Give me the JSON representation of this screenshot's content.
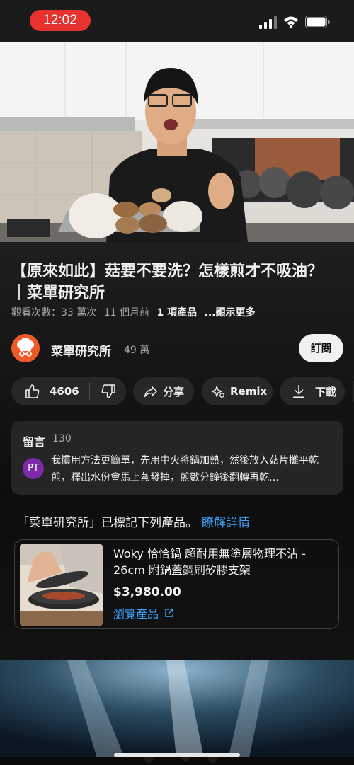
{
  "status_bar": {
    "time": "12:02"
  },
  "video": {
    "label": "video-player"
  },
  "title": "【原來如此】菇要不要洗？怎樣煎才不吸油？｜菜單研究所",
  "meta": {
    "views": "觀看次數：33 萬次",
    "age": "11 個月前",
    "products": "1 項產品",
    "more": "...顯示更多"
  },
  "channel": {
    "name": "菜單研究所",
    "subscribers": "49 萬",
    "subscribe_label": "訂閱"
  },
  "actions": {
    "likes": "4606",
    "share": "分享",
    "remix": "Remix",
    "download": "下載"
  },
  "comments": {
    "title": "留言",
    "count": "130",
    "avatar_initials": "PT",
    "top_comment": "我慣用方法更簡單，先用中火將鍋加熱，然後放入菇片攤平乾煎，釋出水份會馬上蒸發掉，煎數分鐘後翻轉再乾…"
  },
  "products": {
    "intro": "「菜單研究所」已標記下列產品。",
    "learn_more": "瞭解詳情",
    "item": {
      "name": "Woky 恰恰鍋 超耐用無塗層物理不沾 - 26cm 附鍋蓋鋼刷矽膠支架",
      "price": "$3,980.00",
      "browse": "瀏覽產品"
    }
  },
  "colors": {
    "accent_link": "#3ea6ff",
    "time_pill": "#e8322f",
    "channel_avatar": "#f05a28"
  }
}
